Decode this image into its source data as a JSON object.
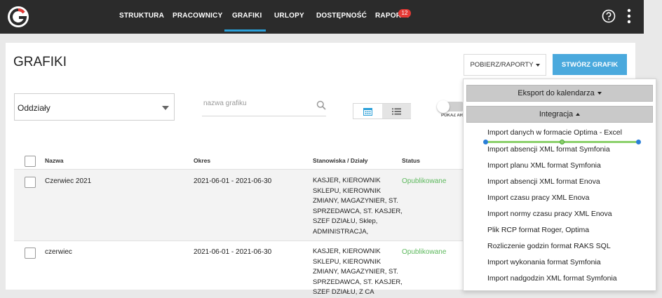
{
  "nav": {
    "items": [
      "STRUKTURA",
      "PRACOWNICY",
      "GRAFIKI",
      "URLOPY",
      "DOSTĘPNOŚĆ",
      "RAPORTY"
    ],
    "active": "GRAFIKI",
    "reports_badge": "12"
  },
  "colors": {
    "accent": "#2a9fd8",
    "create_button": "#4aa9dd",
    "status_published": "#5cb85c",
    "badge": "#e53935",
    "topbar": "#2b2b2b"
  },
  "icons": [
    "logo",
    "help-icon",
    "kebab-menu-icon",
    "search-icon",
    "calendar-icon",
    "list-icon",
    "caret-down-icon",
    "caret-up-icon"
  ],
  "page": {
    "title": "GRAFIKI",
    "reports_button": "POBIERZ/RAPORTY",
    "create_button": "STWÓRZ GRAFIK"
  },
  "filters": {
    "department_select": "Oddziały",
    "search_placeholder": "nazwa grafiku",
    "toggle_label": "POKAŻ ARCHIWALNE"
  },
  "table": {
    "headers": {
      "name": "Nazwa",
      "period": "Okres",
      "positions": "Stanowiska / Działy",
      "status": "Status"
    },
    "rows": [
      {
        "name": "Czerwiec 2021",
        "period": "2021-06-01 - 2021-06-30",
        "positions": [
          "KASJER, KIEROWNIK",
          "SKLEPU, KIEROWNIK",
          "ZMIANY, MAGAZYNIER, ST.",
          "SPRZEDAWCA, ST. KASJER,",
          "SZEF DZIAŁU, Sklep,",
          "ADMINISTRACJA,"
        ],
        "status": "Opublikowane"
      },
      {
        "name": "czerwiec",
        "period": "2021-06-01 - 2021-06-30",
        "positions": [
          "KASJER, KIEROWNIK",
          "SKLEPU, KIEROWNIK",
          "ZMIANY, MAGAZYNIER, ST.",
          "SPRZEDAWCA, ST. KASJER,",
          "SZEF DZIAŁU, Z CA"
        ],
        "status": "Opublikowane"
      }
    ]
  },
  "dropdown": {
    "export_header": "Eksport do kalendarza",
    "integration_header": "Integracja",
    "items": [
      "Import danych w formacie Optima - Excel",
      "Import absencji XML format Symfonia",
      "Import planu XML format Symfonia",
      "Import absencji XML format Enova",
      "Import czasu pracy XML Enova",
      "Import normy czasu pracy XML Enova",
      "Plik RCP format Roger, Optima",
      "Rozliczenie godzin format RAKS SQL",
      "Import wykonania format Symfonia",
      "Import nadgodzin XML format Symfonia"
    ]
  }
}
